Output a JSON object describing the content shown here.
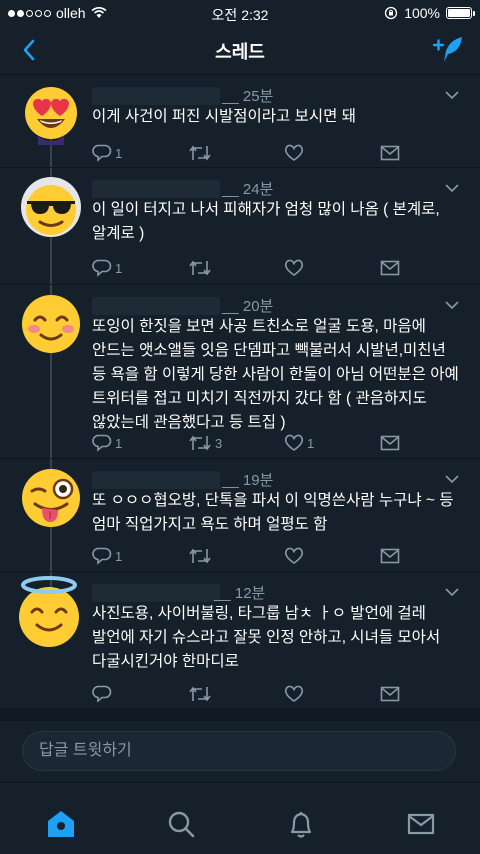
{
  "status_bar": {
    "carrier": "olleh",
    "time": "오전 2:32",
    "battery": "100%",
    "battery_level": 1.0
  },
  "header": {
    "title": "스레드"
  },
  "tweets": [
    {
      "time": "__ 25분",
      "text": "이게 사건이 퍼진 시발점이라고 보시면 돼",
      "replies": "1",
      "retweets": "",
      "likes": "",
      "avatar_icon": "heart-eyes-emoji"
    },
    {
      "time": "__ 24분",
      "text": "이 일이 터지고 나서 피해자가 엄청 많이 나옴 ( 본계로, 알계로 )",
      "replies": "1",
      "retweets": "",
      "likes": "",
      "avatar_icon": "sunglasses-emoji"
    },
    {
      "time": "__ 20분",
      "text": "또잉이 한짓을 보면 사공 트친소로 얼굴 도용, 마음에 안드는 앳소앨들 잇음 단뎀파고 빽불러서 시발년,미친년 등 욕을 함 이렇게 당한 사람이 한둘이 아님 어떤분은 아예 트위터를 접고 미치기 직전까지 갔다 함 ( 관음하지도 않았는데 관음했다고 등 트집 )",
      "replies": "1",
      "retweets": "3",
      "likes": "1",
      "avatar_icon": "smiling-blush-emoji"
    },
    {
      "time": "__ 19분",
      "text": "또 ㅇㅇㅇ협오방, 단톡을 파서 이 익명쓴사람 누구냐 ~ 등 엄마 직업가지고 욕도 하며 얼평도 함",
      "replies": "1",
      "retweets": "",
      "likes": "",
      "avatar_icon": "winking-tongue-emoji"
    },
    {
      "time": "__ 12분",
      "text": "사진도용, 사이버불링, 타그룹 남ㅊ ㅏㅇ 발언에 걸레 발언에 자기 슈스라고 잘못 인정 안하고, 시녀들 모아서 다굴시킨거야 한마디로",
      "replies": "",
      "retweets": "",
      "likes": "",
      "avatar_icon": "halo-emoji"
    }
  ],
  "reply_bar": {
    "placeholder": "답글 트윗하기"
  },
  "tab_bar": {
    "items": [
      "home-icon",
      "search-icon",
      "notifications-icon",
      "messages-icon"
    ],
    "active": "home-icon"
  },
  "colors": {
    "background": "#15202b",
    "accent": "#1da1f2",
    "secondary_text": "#8899a6"
  }
}
